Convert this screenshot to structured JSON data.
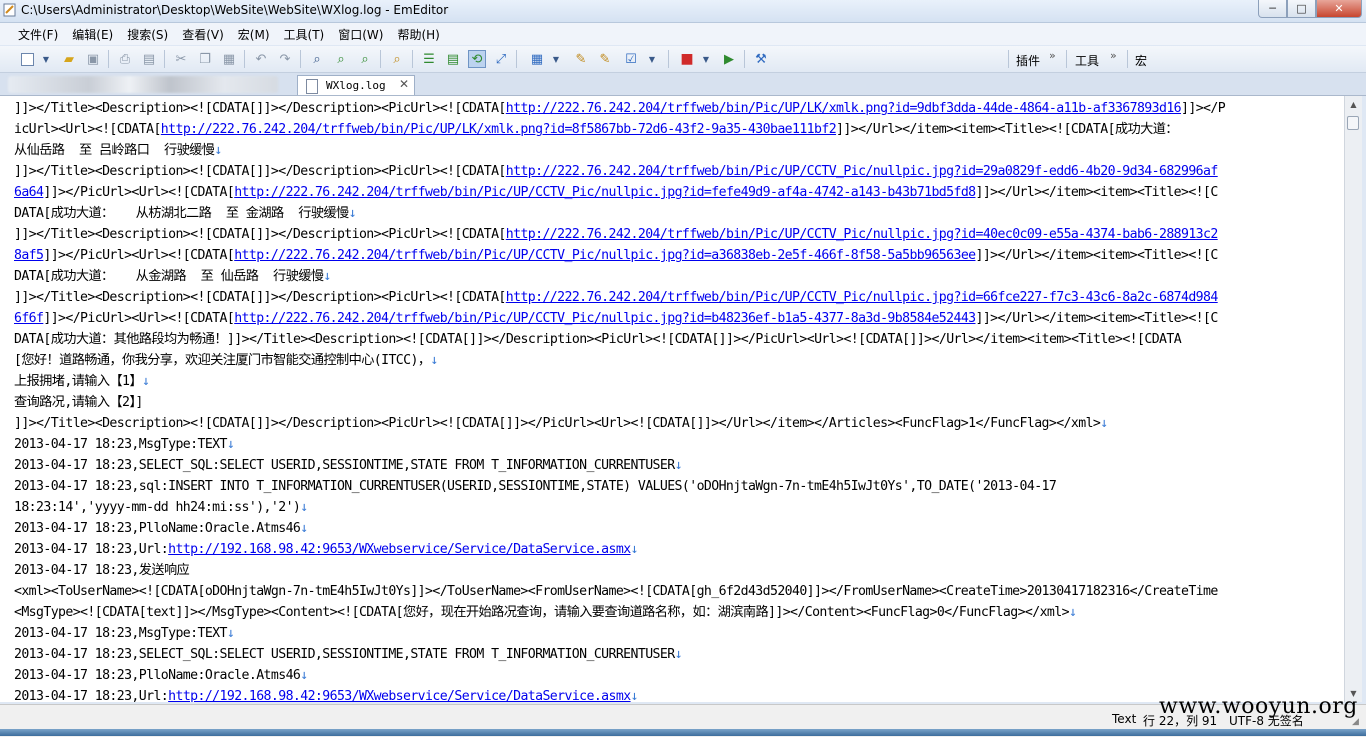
{
  "window": {
    "title": "C:\\Users\\Administrator\\Desktop\\WebSite\\WebSite\\WXlog.log - EmEditor",
    "minimize": "─",
    "maximize": "□",
    "close": "✕"
  },
  "menu": [
    "文件(F)",
    "编辑(E)",
    "搜索(S)",
    "查看(V)",
    "宏(M)",
    "工具(T)",
    "窗口(W)",
    "帮助(H)"
  ],
  "toolbar": {
    "plugins_label": "插件",
    "tools_label": "工具",
    "macro_label": "宏",
    "chevron": "»"
  },
  "tab": {
    "label": "WXlog.log",
    "close": "✕"
  },
  "lines": [
    [
      {
        "t": "]]></Title><Description><![CDATA[]]></Description><PicUrl><![CDATA["
      },
      {
        "l": "http://222.76.242.204/trffweb/bin/Pic/UP/LK/xmlk.png?id=9dbf3dda-44de-4864-a11b-af3367893d16"
      },
      {
        "t": "]]></P"
      }
    ],
    [
      {
        "t": "icUrl><Url><![CDATA["
      },
      {
        "l": "http://222.76.242.204/trffweb/bin/Pic/UP/LK/xmlk.png?id=8f5867bb-72d6-43f2-9a35-430bae111bf2"
      },
      {
        "t": "]]></Url></item><item><Title><![CDATA[成功大道："
      }
    ],
    [
      {
        "t": "从仙岳路  至 吕岭路口  行驶缓慢"
      },
      {
        "e": "↓"
      }
    ],
    [
      {
        "t": "]]></Title><Description><![CDATA[]]></Description><PicUrl><![CDATA["
      },
      {
        "l": "http://222.76.242.204/trffweb/bin/Pic/UP/CCTV_Pic/nullpic.jpg?id=29a0829f-edd6-4b20-9d34-682996af"
      }
    ],
    [
      {
        "l": "6a64"
      },
      {
        "t": "]]></PicUrl><Url><![CDATA["
      },
      {
        "l": "http://222.76.242.204/trffweb/bin/Pic/UP/CCTV_Pic/nullpic.jpg?id=fefe49d9-af4a-4742-a143-b43b71bd5fd8"
      },
      {
        "t": "]]></Url></item><item><Title><![C"
      }
    ],
    [
      {
        "t": "DATA[成功大道：   从枋湖北二路  至 金湖路  行驶缓慢"
      },
      {
        "e": "↓"
      }
    ],
    [
      {
        "t": "]]></Title><Description><![CDATA[]]></Description><PicUrl><![CDATA["
      },
      {
        "l": "http://222.76.242.204/trffweb/bin/Pic/UP/CCTV_Pic/nullpic.jpg?id=40ec0c09-e55a-4374-bab6-288913c2"
      }
    ],
    [
      {
        "l": "8af5"
      },
      {
        "t": "]]></PicUrl><Url><![CDATA["
      },
      {
        "l": "http://222.76.242.204/trffweb/bin/Pic/UP/CCTV_Pic/nullpic.jpg?id=a36838eb-2e5f-466f-8f58-5a5bb96563ee"
      },
      {
        "t": "]]></Url></item><item><Title><![C"
      }
    ],
    [
      {
        "t": "DATA[成功大道：   从金湖路  至 仙岳路  行驶缓慢"
      },
      {
        "e": "↓"
      }
    ],
    [
      {
        "t": "]]></Title><Description><![CDATA[]]></Description><PicUrl><![CDATA["
      },
      {
        "l": "http://222.76.242.204/trffweb/bin/Pic/UP/CCTV_Pic/nullpic.jpg?id=66fce227-f7c3-43c6-8a2c-6874d984"
      }
    ],
    [
      {
        "l": "6f6f"
      },
      {
        "t": "]]></PicUrl><Url><![CDATA["
      },
      {
        "l": "http://222.76.242.204/trffweb/bin/Pic/UP/CCTV_Pic/nullpic.jpg?id=b48236ef-b1a5-4377-8a3d-9b8584e52443"
      },
      {
        "t": "]]></Url></item><item><Title><![C"
      }
    ],
    [
      {
        "t": "DATA[成功大道：其他路段均为畅通！]]></Title><Description><![CDATA[]]></Description><PicUrl><![CDATA[]]></PicUrl><Url><![CDATA[]]></Url></item><item><Title><![CDATA"
      }
    ],
    [
      {
        "t": "[您好！道路畅通，你我分享，欢迎关注厦门市智能交通控制中心(ITCC)，"
      },
      {
        "e": "↓"
      }
    ],
    [
      {
        "t": "上报拥堵,请输入【1】"
      },
      {
        "e": "↓"
      }
    ],
    [
      {
        "t": "查询路况,请输入【2】]"
      }
    ],
    [
      {
        "t": "]]></Title><Description><![CDATA[]]></Description><PicUrl><![CDATA[]]></PicUrl><Url><![CDATA[]]></Url></item></Articles><FuncFlag>1</FuncFlag></xml>"
      },
      {
        "e": "↓"
      }
    ],
    [
      {
        "t": "2013-04-17 18:23,MsgType:TEXT"
      },
      {
        "e": "↓"
      }
    ],
    [
      {
        "t": "2013-04-17 18:23,SELECT_SQL:SELECT USERID,SESSIONTIME,STATE FROM T_INFORMATION_CURRENTUSER"
      },
      {
        "e": "↓"
      }
    ],
    [
      {
        "t": "2013-04-17 18:23,sql:INSERT INTO T_INFORMATION_CURRENTUSER(USERID,SESSIONTIME,STATE) VALUES('oDOHnjtaWgn-7n-tmE4h5IwJt0Ys',TO_DATE('2013-04-17"
      }
    ],
    [
      {
        "t": "18:23:14','yyyy-mm-dd hh24:mi:ss'),'2')"
      },
      {
        "e": "↓"
      }
    ],
    [
      {
        "t": "2013-04-17 18:23,PlloName:Oracle.Atms46"
      },
      {
        "e": "↓"
      }
    ],
    [
      {
        "t": "2013-04-17 18:23,Url:"
      },
      {
        "l": "http://192.168.98.42:9653/WXwebservice/Service/DataService.asmx"
      },
      {
        "e": "↓"
      }
    ],
    [
      {
        "t": "2013-04-17 18:23,发送响应"
      }
    ],
    [
      {
        "t": "<xml><ToUserName><![CDATA[oDOHnjtaWgn-7n-tmE4h5IwJt0Ys]]></ToUserName><FromUserName><![CDATA[gh_6f2d43d52040]]></FromUserName><CreateTime>20130417182316</CreateTime"
      }
    ],
    [
      {
        "t": "<MsgType><![CDATA[text]]></MsgType><Content><![CDATA[您好，现在开始路况查询，请输入要查询道路名称，如：湖滨南路]]></Content><FuncFlag>0</FuncFlag></xml>"
      },
      {
        "e": "↓"
      }
    ],
    [
      {
        "t": "2013-04-17 18:23,MsgType:TEXT"
      },
      {
        "e": "↓"
      }
    ],
    [
      {
        "t": "2013-04-17 18:23,SELECT_SQL:SELECT USERID,SESSIONTIME,STATE FROM T_INFORMATION_CURRENTUSER"
      },
      {
        "e": "↓"
      }
    ],
    [
      {
        "t": "2013-04-17 18:23,PlloName:Oracle.Atms46"
      },
      {
        "e": "↓"
      }
    ],
    [
      {
        "t": "2013-04-17 18:23,Url:"
      },
      {
        "l": "http://192.168.98.42:9653/WXwebservice/Service/DataService.asmx"
      },
      {
        "e": "↓"
      }
    ]
  ],
  "status": {
    "mode": "Text",
    "position": "行 22，列 91",
    "encoding": "UTF-8 无签名"
  },
  "watermark": "www.wooyun.org",
  "colors": {
    "link": "#0000ee",
    "eol_marker": "#3a7bd5"
  }
}
